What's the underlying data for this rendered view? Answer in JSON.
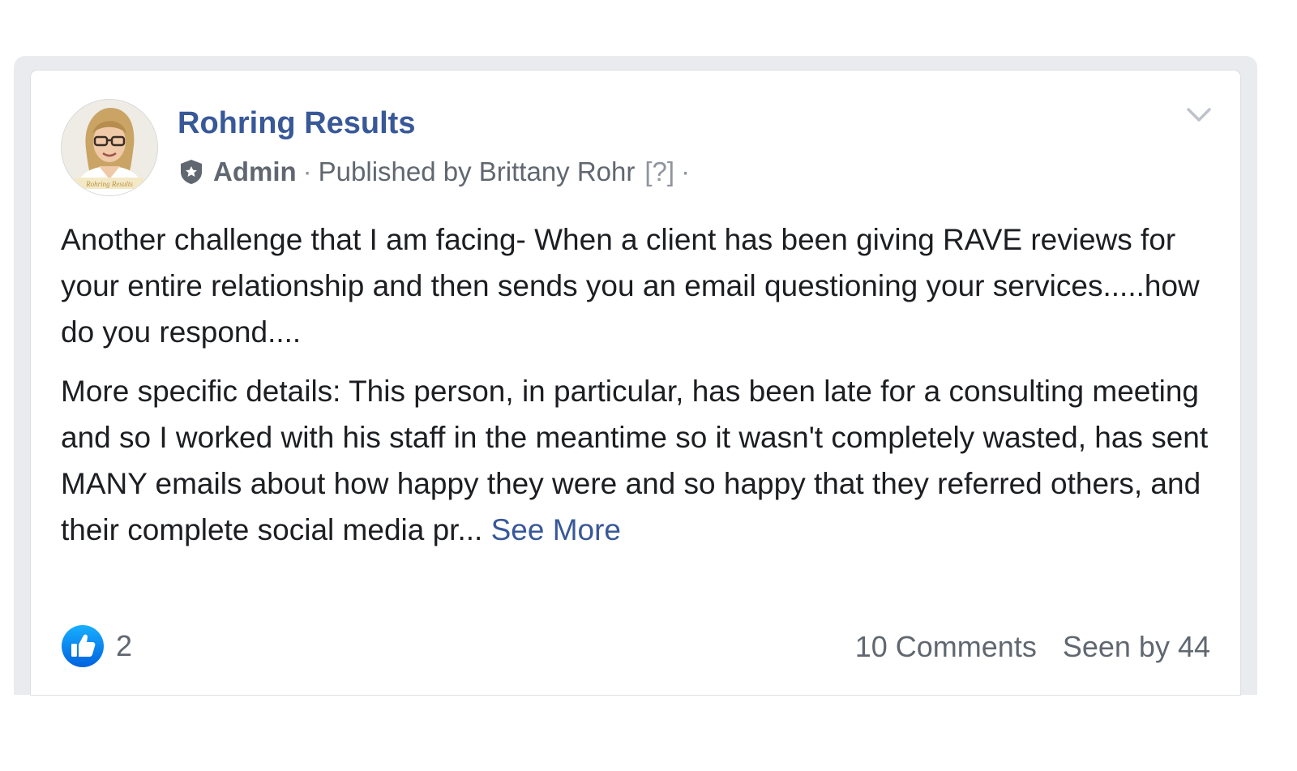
{
  "post": {
    "page_name": "Rohring Results",
    "role": "Admin",
    "separator": "·",
    "published_by": "Published by Brittany Rohr",
    "help": "[?]",
    "trailing_dot": "·",
    "avatar_logo_text": "Rohring Results",
    "paragraph1": "Another challenge that I am facing- When a client has been giving RAVE reviews for your entire relationship and then sends you an email questioning your services.....how do you respond....",
    "paragraph2": "More specific details: This person, in particular, has been late for a consulting meeting and so I worked with his staff in the meantime so it wasn't completely wasted, has sent MANY emails about how happy they were and so happy that they referred others, and their complete social media pr...",
    "see_more": "See More"
  },
  "footer": {
    "like_count": "2",
    "comments": "10 Comments",
    "seen_by": "Seen by 44"
  },
  "icons": {
    "role_badge": "shield-star-icon",
    "menu": "chevron-down-icon",
    "reaction": "like-thumbs-up-icon"
  },
  "colors": {
    "link": "#385898",
    "text": "#1c1e21",
    "secondary": "#606770",
    "like_blue": "#1877f2",
    "frame": "#e9ebee"
  }
}
